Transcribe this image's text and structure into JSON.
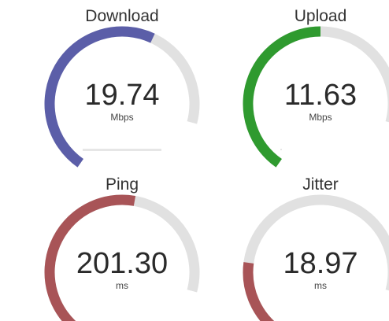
{
  "gauges": {
    "download": {
      "title": "Download",
      "value": "19.74",
      "unit": "Mbps",
      "fill": 0.68,
      "color": "#5b5ea8"
    },
    "upload": {
      "title": "Upload",
      "value": "11.63",
      "unit": "Mbps",
      "fill": 0.58,
      "color": "#2f9a2f"
    },
    "ping": {
      "title": "Ping",
      "value": "201.30",
      "unit": "ms",
      "fill": 0.62,
      "color": "#a85457"
    },
    "jitter": {
      "title": "Jitter",
      "value": "18.97",
      "unit": "ms",
      "fill": 0.25,
      "color": "#a85457"
    }
  },
  "colors": {
    "track": "#e1e1e1"
  }
}
